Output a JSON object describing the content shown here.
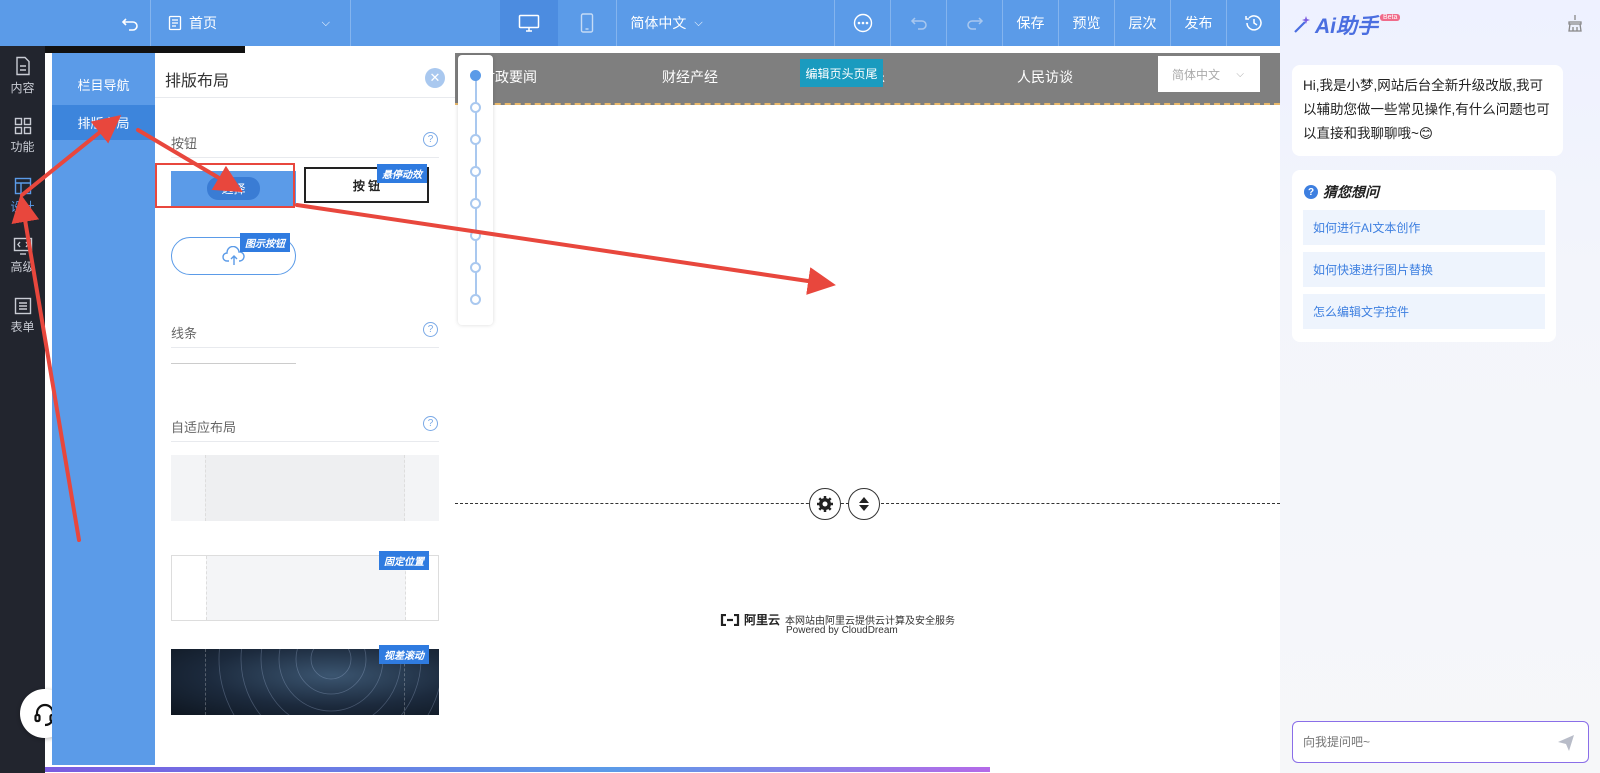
{
  "toolbar": {
    "page_name": "首页",
    "language": "简体中文",
    "save": "保存",
    "preview": "预览",
    "layers": "层次",
    "publish": "发布"
  },
  "left_rail": [
    {
      "label": "内容",
      "icon": "file-icon"
    },
    {
      "label": "功能",
      "icon": "grid-icon"
    },
    {
      "label": "设计",
      "icon": "layout-icon",
      "active": true
    },
    {
      "label": "高级",
      "icon": "code-icon"
    },
    {
      "label": "表单",
      "icon": "form-icon"
    }
  ],
  "panel_nav": [
    "栏目导航",
    "排版布局"
  ],
  "panel": {
    "title": "排版布局",
    "sections": {
      "button": "按钮",
      "line": "线条",
      "adaptive": "自适应布局"
    },
    "button_samples": [
      "选择",
      "按 钮"
    ],
    "tags": {
      "hover": "悬停动效",
      "icon_button": "图示按钮",
      "fixed": "固定位置",
      "parallax": "视差滚动"
    }
  },
  "site_nav": {
    "items": [
      "时政要闻",
      "财经产经",
      "乐",
      "人民访谈"
    ],
    "edit_badge": "编辑页头页尾",
    "language_select": "简体中文"
  },
  "footer": {
    "brand": "阿里云",
    "line1": "本网站由阿里云提供云计算及安全服务",
    "line2": "Powered by CloudDream"
  },
  "ai": {
    "title": "Ai助手",
    "badge": "Beta",
    "greeting": "Hi,我是小梦,网站后台全新升级改版,我可以辅助您做一些常见操作,有什么问题也可以直接和我聊聊哦~😊",
    "guess_title": "猜您想问",
    "suggestions": [
      "如何进行AI文本创作",
      "如何快速进行图片替换",
      "怎么编辑文字控件"
    ],
    "input_placeholder": "向我提问吧~"
  },
  "colors": {
    "primary": "#5b9be8",
    "rail_bg": "#22252e",
    "arrow": "#e8473d",
    "highlight_border": "#e8473d"
  }
}
